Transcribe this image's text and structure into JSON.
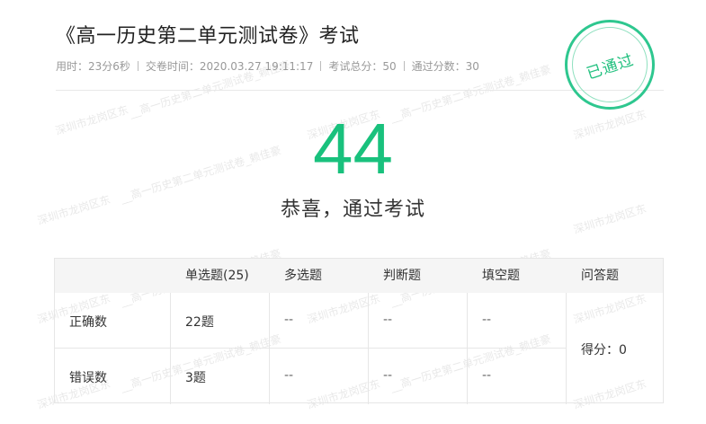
{
  "exam": {
    "title": "《高一历史第二单元测试卷》考试",
    "time_used": "用时：23分6秒",
    "submit_time": "交卷时间：2020.03.27 19:11:17",
    "total_score": "考试总分：50",
    "pass_score": "通过分数：30"
  },
  "stamp": {
    "label": "已通过",
    "color": "#22c07f"
  },
  "result": {
    "score": "44",
    "message": "恭喜，通过考试",
    "accent": "#19c17d"
  },
  "table": {
    "headers": [
      "",
      "单选题(25)",
      "多选题",
      "判断题",
      "填空题",
      "问答题"
    ],
    "rows": [
      {
        "label": "正确数",
        "single": "22题",
        "multi": "--",
        "judge": "--",
        "fill": "--"
      },
      {
        "label": "错误数",
        "single": "3题",
        "multi": "--",
        "judge": "--",
        "fill": "--"
      }
    ],
    "essay": "得分：0"
  },
  "watermark": {
    "location": "深圳市龙岗区东",
    "text": "__高一历史第二单元测试卷_赖佳豪"
  }
}
